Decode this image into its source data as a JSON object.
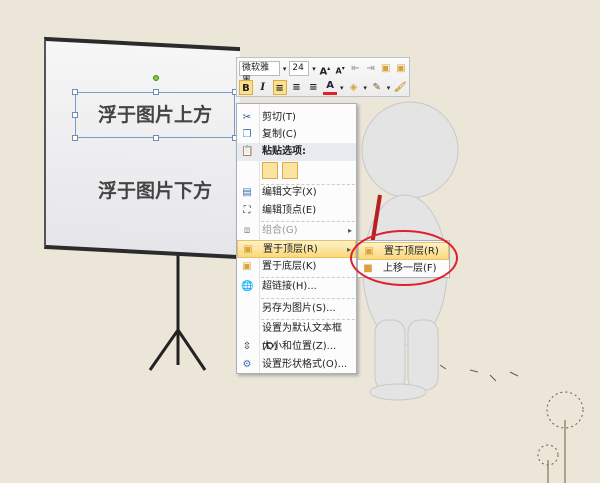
{
  "slide": {
    "text_above": "浮于图片上方",
    "text_below": "浮于图片下方"
  },
  "toolbar": {
    "font": "微软雅黑",
    "size": "24",
    "bold": "B",
    "italic": "I"
  },
  "menu": {
    "cut": "剪切(T)",
    "copy": "复制(C)",
    "paste_options": "粘贴选项:",
    "edit_text": "编辑文字(X)",
    "edit_points": "编辑顶点(E)",
    "group": "组合(G)",
    "bring_front": "置于顶层(R)",
    "send_back": "置于底层(K)",
    "hyperlink": "超链接(H)...",
    "save_picture": "另存为图片(S)...",
    "set_default": "设置为默认文本框(D)",
    "size_position": "大小和位置(Z)...",
    "format_shape": "设置形状格式(O)..."
  },
  "submenu": {
    "bring_to_front": "置于顶层(R)",
    "bring_forward": "上移一层(F)"
  },
  "colors": {
    "highlight": "#fbd97a",
    "annotation": "#e0202a"
  }
}
